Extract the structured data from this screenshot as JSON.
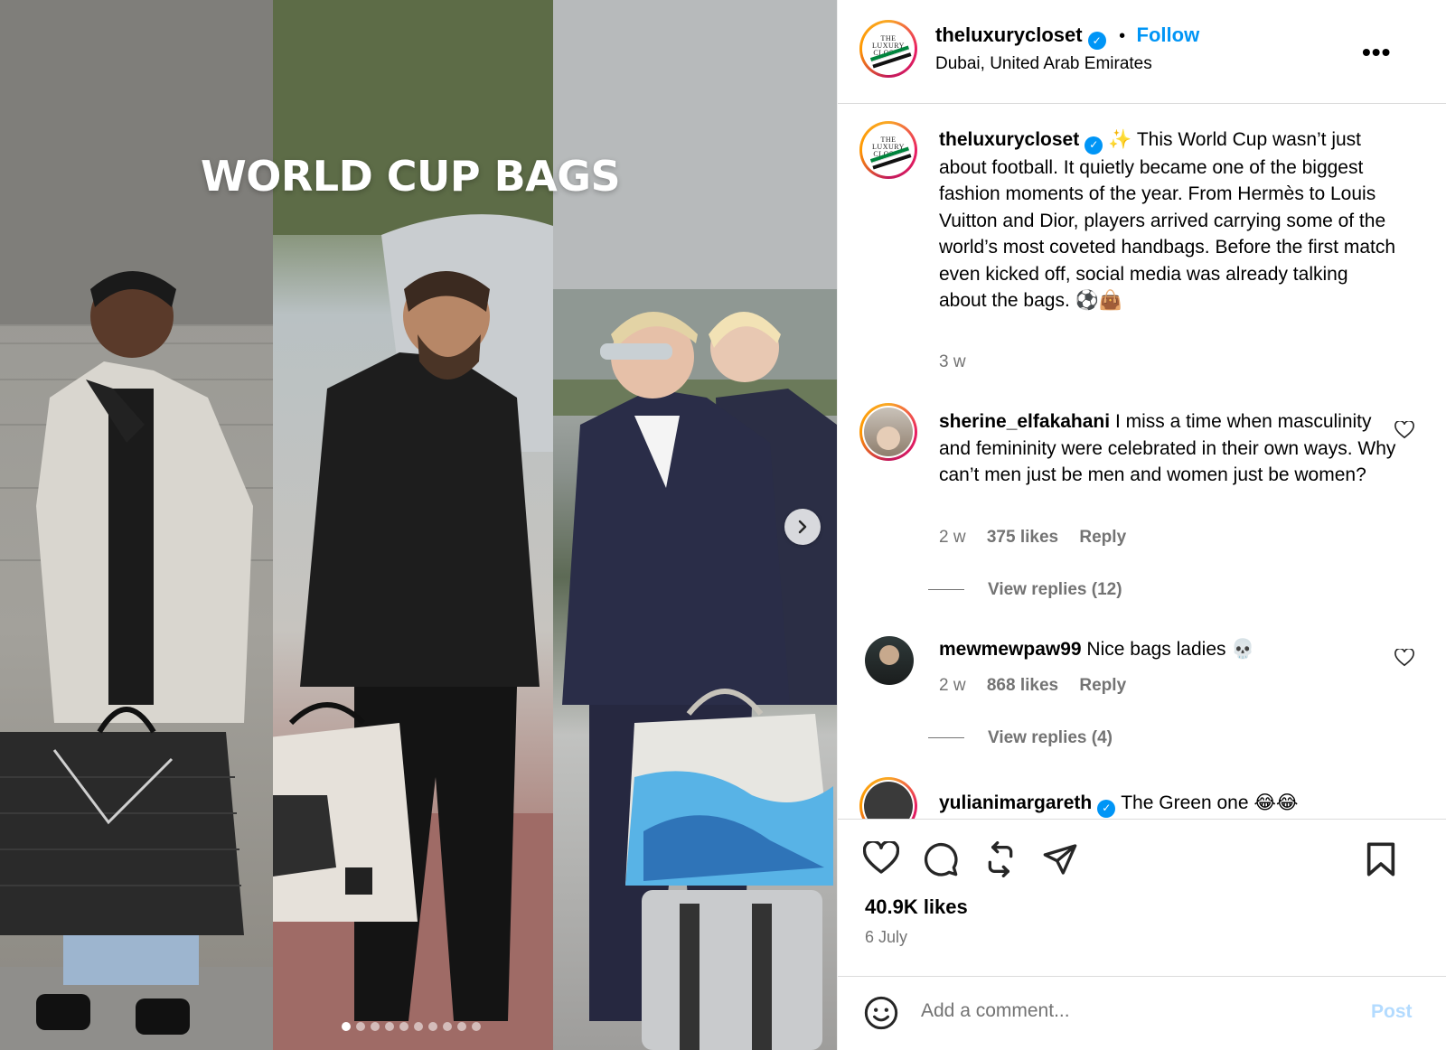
{
  "media": {
    "overlay_title": "WORLD CUP BAGS",
    "carousel_dots": 10,
    "active_dot": 0
  },
  "post": {
    "username": "theluxurycloset",
    "verified": true,
    "separator": "•",
    "follow_label": "Follow",
    "location": "Dubai, United Arab Emirates",
    "logo_text": "THE LUXURY CLOSET",
    "caption": "✨ This World Cup wasn’t just about football. It quietly became one of the biggest fashion moments of the year. From Hermès to Louis Vuitton and Dior, players arrived carrying some of the world’s most coveted handbags. Before the first match even kicked off, social media was already talking about the bags. ⚽👜",
    "caption_time": "3 w"
  },
  "comments": [
    {
      "username": "sherine_elfakahani",
      "text": "I miss a time when masculinity and femininity were celebrated in their own ways. Why can’t men just be men and women just be women?",
      "time": "2 w",
      "likes": "375 likes",
      "reply_label": "Reply",
      "view_replies": "View replies (12)"
    },
    {
      "username": "mewmewpaw99",
      "text": "Nice bags ladies 💀",
      "time": "2 w",
      "likes": "868 likes",
      "reply_label": "Reply",
      "view_replies": "View replies (4)"
    },
    {
      "username": "yulianimargareth",
      "text": "The Green one 😂😂"
    }
  ],
  "actions": {
    "icons": [
      "heart-icon",
      "comment-icon",
      "repost-icon",
      "share-icon",
      "bookmark-icon"
    ],
    "likes": "40.9K likes",
    "date": "6 July"
  },
  "add_comment": {
    "placeholder": "Add a comment...",
    "post_label": "Post"
  },
  "colors": {
    "link_blue": "#0095f6",
    "muted": "#737373",
    "post_disabled": "#b3dbff"
  }
}
